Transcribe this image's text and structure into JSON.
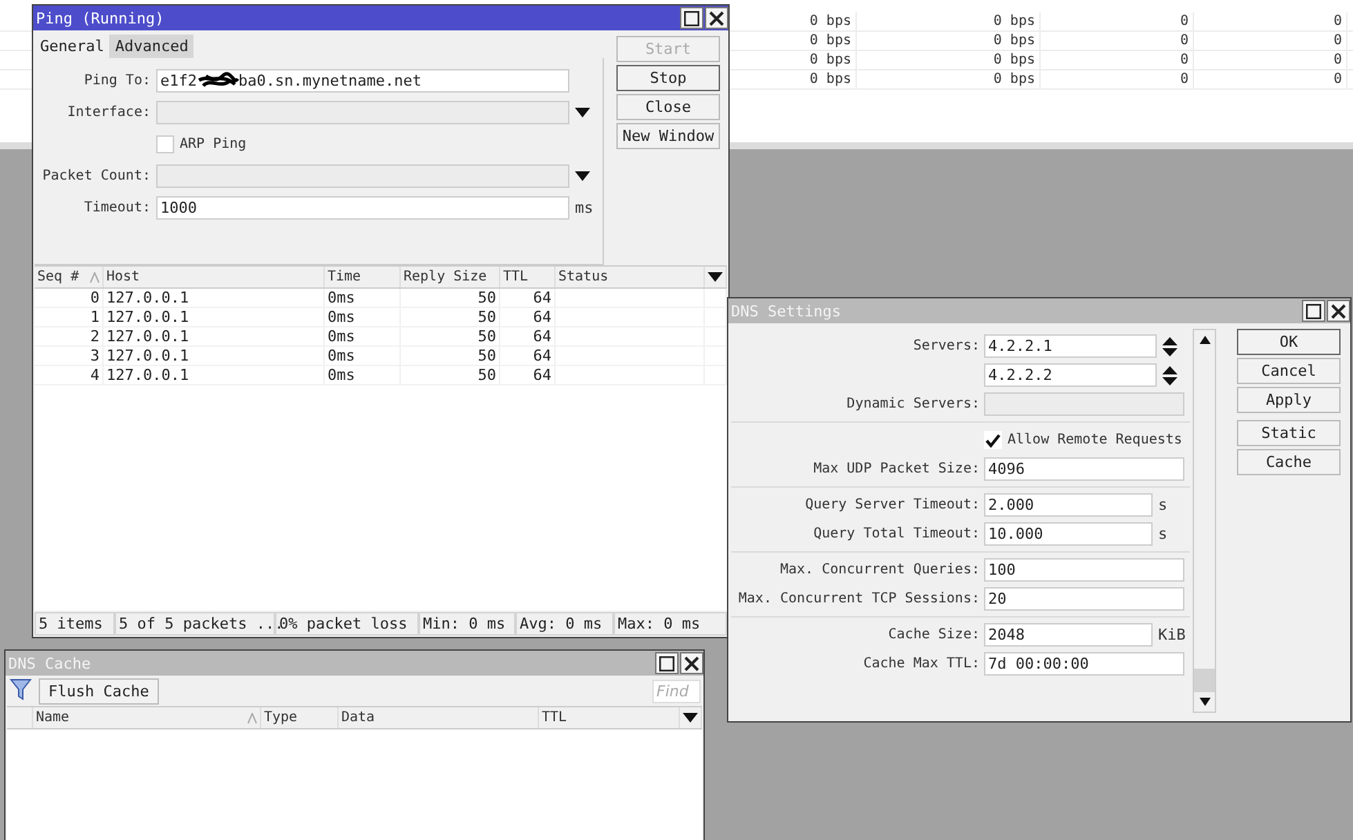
{
  "background_table": {
    "rows": [
      {
        "cells": [
          "0 bps",
          "0 bps",
          "0",
          "0"
        ]
      },
      {
        "cells": [
          "0 bps",
          "0 bps",
          "0",
          "0"
        ]
      },
      {
        "cells": [
          "0 bps",
          "0 bps",
          "0",
          "0"
        ]
      },
      {
        "cells": [
          "0 bps",
          "0 bps",
          "0",
          "0"
        ]
      }
    ]
  },
  "ping_window": {
    "title": "Ping (Running)",
    "active": true,
    "tabs": [
      {
        "label": "General",
        "selected": true
      },
      {
        "label": "Advanced",
        "selected": false
      }
    ],
    "fields": [
      {
        "kind": "redacted",
        "label": "Ping To:",
        "value_start": "e1f2",
        "value_end": "ba0.sn.mynetname.net"
      },
      {
        "kind": "dropdown",
        "label": "Interface:"
      },
      {
        "kind": "checkbox",
        "label": "ARP Ping",
        "checked": false
      },
      {
        "kind": "dropdown",
        "label": "Packet Count:"
      },
      {
        "kind": "text",
        "label": "Timeout:",
        "value": "1000",
        "unit": "ms"
      }
    ],
    "buttons": [
      {
        "label": "Start",
        "disabled": true,
        "emphasized": false
      },
      {
        "label": "Stop",
        "disabled": false,
        "emphasized": true
      },
      {
        "label": "Close",
        "disabled": false,
        "emphasized": false
      },
      {
        "label": "New Window",
        "disabled": false,
        "emphasized": false
      }
    ],
    "table": {
      "columns": [
        {
          "label": "Seq #",
          "sorted": true
        },
        {
          "label": "Host",
          "sorted": false
        },
        {
          "label": "Time",
          "sorted": false
        },
        {
          "label": "Reply Size",
          "sorted": false
        },
        {
          "label": "TTL",
          "sorted": false
        },
        {
          "label": "Status",
          "sorted": false
        }
      ],
      "rows": [
        [
          "0",
          "127.0.0.1",
          "0ms",
          "50",
          "64",
          ""
        ],
        [
          "1",
          "127.0.0.1",
          "0ms",
          "50",
          "64",
          ""
        ],
        [
          "2",
          "127.0.0.1",
          "0ms",
          "50",
          "64",
          ""
        ],
        [
          "3",
          "127.0.0.1",
          "0ms",
          "50",
          "64",
          ""
        ],
        [
          "4",
          "127.0.0.1",
          "0ms",
          "50",
          "64",
          ""
        ]
      ]
    },
    "status_bar": [
      "5 items",
      "5 of 5 packets ...",
      "0% packet loss",
      "Min: 0 ms",
      "Avg: 0 ms",
      "Max: 0 ms"
    ]
  },
  "dns_settings": {
    "title": "DNS Settings",
    "active": false,
    "groups": [
      [
        {
          "kind": "server",
          "label": "Servers:",
          "value": "4.2.2.1"
        },
        {
          "kind": "server",
          "value": "4.2.2.2"
        },
        {
          "kind": "readonly",
          "label": "Dynamic Servers:"
        }
      ],
      [
        {
          "kind": "checkbox",
          "label": "Allow Remote Requests",
          "checked": true
        },
        {
          "kind": "input",
          "label": "Max UDP Packet Size:",
          "value": "4096"
        }
      ],
      [
        {
          "kind": "input",
          "label": "Query Server Timeout:",
          "value": "2.000",
          "unit": "s"
        },
        {
          "kind": "input",
          "label": "Query Total Timeout:",
          "value": "10.000",
          "unit": "s"
        }
      ],
      [
        {
          "kind": "input",
          "label": "Max. Concurrent Queries:",
          "value": "100"
        },
        {
          "kind": "input",
          "label": "Max. Concurrent TCP Sessions:",
          "value": "20"
        }
      ],
      [
        {
          "kind": "input",
          "label": "Cache Size:",
          "value": "2048",
          "unit": "KiB"
        },
        {
          "kind": "input",
          "label": "Cache Max TTL:",
          "value": "7d 00:00:00"
        }
      ]
    ],
    "buttons": [
      {
        "label": "OK",
        "emphasized": true
      },
      {
        "label": "Cancel",
        "emphasized": false
      },
      {
        "label": "Apply",
        "emphasized": false
      },
      {
        "label": "Static",
        "emphasized": false
      },
      {
        "label": "Cache",
        "emphasized": false
      }
    ]
  },
  "dns_cache": {
    "title": "DNS Cache",
    "active": false,
    "flush_button": "Flush Cache",
    "search": {
      "placeholder": "Find"
    },
    "columns": [
      {
        "label": "Name",
        "sorted": true
      },
      {
        "label": "Type",
        "sorted": false
      },
      {
        "label": "Data",
        "sorted": false
      },
      {
        "label": "TTL",
        "sorted": false
      }
    ]
  }
}
